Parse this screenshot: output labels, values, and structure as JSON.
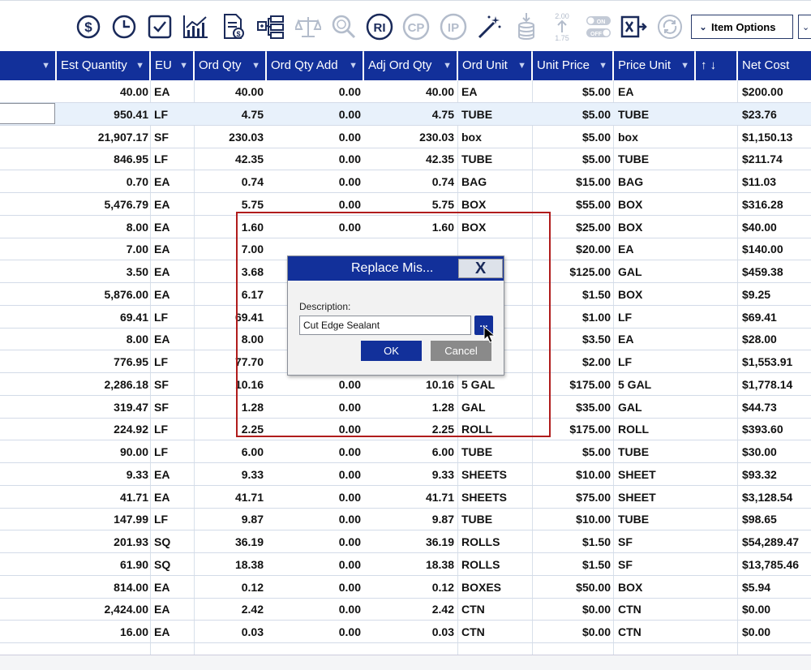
{
  "toolbar": {
    "icons": [
      "dollar-icon",
      "clock-icon",
      "checkbox-icon",
      "chart-icon",
      "invoice-icon",
      "tree-icon",
      "scale-icon",
      "search-money-icon",
      "ri-icon",
      "cp-icon",
      "ip-icon",
      "magic-wand-icon",
      "stack-down-icon",
      "pricing-update-icon",
      "toggle-on-off-icon",
      "excel-export-icon",
      "refresh-icon"
    ],
    "ri_label": "RI",
    "cp_label": "CP",
    "ip_label": "IP",
    "price_top": "2.00",
    "price_bottom": "1.75",
    "toggle_on": "ON",
    "toggle_off": "OFF",
    "item_options_label": "Item Options"
  },
  "columns": {
    "est_quantity": "Est Quantity",
    "eu": "EU",
    "ord_qty": "Ord Qty",
    "ord_qty_add": "Ord Qty Add",
    "adj_ord_qty": "Adj Ord Qty",
    "ord_unit": "Ord Unit",
    "unit_price": "Unit Price",
    "price_unit": "Price Unit",
    "sort_arrows": "↑ ↓",
    "net_cost": "Net Cost"
  },
  "rows": [
    {
      "est": "40.00",
      "eu": "EA",
      "ordqty": "40.00",
      "add": "0.00",
      "adj": "40.00",
      "unit": "EA",
      "price": "$5.00",
      "punit": "EA",
      "net": "$200.00"
    },
    {
      "est": "950.41",
      "eu": "LF",
      "ordqty": "4.75",
      "add": "0.00",
      "adj": "4.75",
      "unit": "TUBE",
      "price": "$5.00",
      "punit": "TUBE",
      "net": "$23.76"
    },
    {
      "est": "21,907.17",
      "eu": "SF",
      "ordqty": "230.03",
      "add": "0.00",
      "adj": "230.03",
      "unit": "box",
      "price": "$5.00",
      "punit": "box",
      "net": "$1,150.13"
    },
    {
      "est": "846.95",
      "eu": "LF",
      "ordqty": "42.35",
      "add": "0.00",
      "adj": "42.35",
      "unit": "TUBE",
      "price": "$5.00",
      "punit": "TUBE",
      "net": "$211.74"
    },
    {
      "est": "0.70",
      "eu": "EA",
      "ordqty": "0.74",
      "add": "0.00",
      "adj": "0.74",
      "unit": "BAG",
      "price": "$15.00",
      "punit": "BAG",
      "net": "$11.03"
    },
    {
      "est": "5,476.79",
      "eu": "EA",
      "ordqty": "5.75",
      "add": "0.00",
      "adj": "5.75",
      "unit": "BOX",
      "price": "$55.00",
      "punit": "BOX",
      "net": "$316.28"
    },
    {
      "est": "8.00",
      "eu": "EA",
      "ordqty": "1.60",
      "add": "0.00",
      "adj": "1.60",
      "unit": "BOX",
      "price": "$25.00",
      "punit": "BOX",
      "net": "$40.00"
    },
    {
      "est": "7.00",
      "eu": "EA",
      "ordqty": "7.00",
      "add": "",
      "adj": "",
      "unit": "",
      "price": "$20.00",
      "punit": "EA",
      "net": "$140.00"
    },
    {
      "est": "3.50",
      "eu": "EA",
      "ordqty": "3.68",
      "add": "",
      "adj": "",
      "unit": "",
      "price": "$125.00",
      "punit": "GAL",
      "net": "$459.38"
    },
    {
      "est": "5,876.00",
      "eu": "EA",
      "ordqty": "6.17",
      "add": "",
      "adj": "",
      "unit": "",
      "price": "$1.50",
      "punit": "BOX",
      "net": "$9.25"
    },
    {
      "est": "69.41",
      "eu": "LF",
      "ordqty": "69.41",
      "add": "",
      "adj": "",
      "unit": "",
      "price": "$1.00",
      "punit": "LF",
      "net": "$69.41"
    },
    {
      "est": "8.00",
      "eu": "EA",
      "ordqty": "8.00",
      "add": "",
      "adj": "",
      "unit": "",
      "price": "$3.50",
      "punit": "EA",
      "net": "$28.00"
    },
    {
      "est": "776.95",
      "eu": "LF",
      "ordqty": "77.70",
      "add": "",
      "adj": "",
      "unit": "",
      "price": "$2.00",
      "punit": "LF",
      "net": "$1,553.91"
    },
    {
      "est": "2,286.18",
      "eu": "SF",
      "ordqty": "10.16",
      "add": "0.00",
      "adj": "10.16",
      "unit": "5 GAL",
      "price": "$175.00",
      "punit": "5 GAL",
      "net": "$1,778.14"
    },
    {
      "est": "319.47",
      "eu": "SF",
      "ordqty": "1.28",
      "add": "0.00",
      "adj": "1.28",
      "unit": "GAL",
      "price": "$35.00",
      "punit": "GAL",
      "net": "$44.73"
    },
    {
      "est": "224.92",
      "eu": "LF",
      "ordqty": "2.25",
      "add": "0.00",
      "adj": "2.25",
      "unit": "ROLL",
      "price": "$175.00",
      "punit": "ROLL",
      "net": "$393.60"
    },
    {
      "est": "90.00",
      "eu": "LF",
      "ordqty": "6.00",
      "add": "0.00",
      "adj": "6.00",
      "unit": "TUBE",
      "price": "$5.00",
      "punit": "TUBE",
      "net": "$30.00"
    },
    {
      "est": "9.33",
      "eu": "EA",
      "ordqty": "9.33",
      "add": "0.00",
      "adj": "9.33",
      "unit": "SHEETS",
      "price": "$10.00",
      "punit": "SHEET",
      "net": "$93.32"
    },
    {
      "est": "41.71",
      "eu": "EA",
      "ordqty": "41.71",
      "add": "0.00",
      "adj": "41.71",
      "unit": "SHEETS",
      "price": "$75.00",
      "punit": "SHEET",
      "net": "$3,128.54"
    },
    {
      "est": "147.99",
      "eu": "LF",
      "ordqty": "9.87",
      "add": "0.00",
      "adj": "9.87",
      "unit": "TUBE",
      "price": "$10.00",
      "punit": "TUBE",
      "net": "$98.65"
    },
    {
      "est": "201.93",
      "eu": "SQ",
      "ordqty": "36.19",
      "add": "0.00",
      "adj": "36.19",
      "unit": "ROLLS",
      "price": "$1.50",
      "punit": "SF",
      "net": "$54,289.47"
    },
    {
      "est": "61.90",
      "eu": "SQ",
      "ordqty": "18.38",
      "add": "0.00",
      "adj": "18.38",
      "unit": "ROLLS",
      "price": "$1.50",
      "punit": "SF",
      "net": "$13,785.46"
    },
    {
      "est": "814.00",
      "eu": "EA",
      "ordqty": "0.12",
      "add": "0.00",
      "adj": "0.12",
      "unit": "BOXES",
      "price": "$50.00",
      "punit": "BOX",
      "net": "$5.94"
    },
    {
      "est": "2,424.00",
      "eu": "EA",
      "ordqty": "2.42",
      "add": "0.00",
      "adj": "2.42",
      "unit": "CTN",
      "price": "$0.00",
      "punit": "CTN",
      "net": "$0.00"
    },
    {
      "est": "16.00",
      "eu": "EA",
      "ordqty": "0.03",
      "add": "0.00",
      "adj": "0.03",
      "unit": "CTN",
      "price": "$0.00",
      "punit": "CTN",
      "net": "$0.00"
    }
  ],
  "dialog": {
    "title": "Replace Mis...",
    "close": "X",
    "description_label": "Description:",
    "description_value": "Cut Edge Sealant",
    "browse": "...",
    "ok": "OK",
    "cancel": "Cancel"
  },
  "colors": {
    "header_blue": "#12309a",
    "highlight_red": "#b01c1c",
    "cancel_gray": "#8a8a8a"
  }
}
